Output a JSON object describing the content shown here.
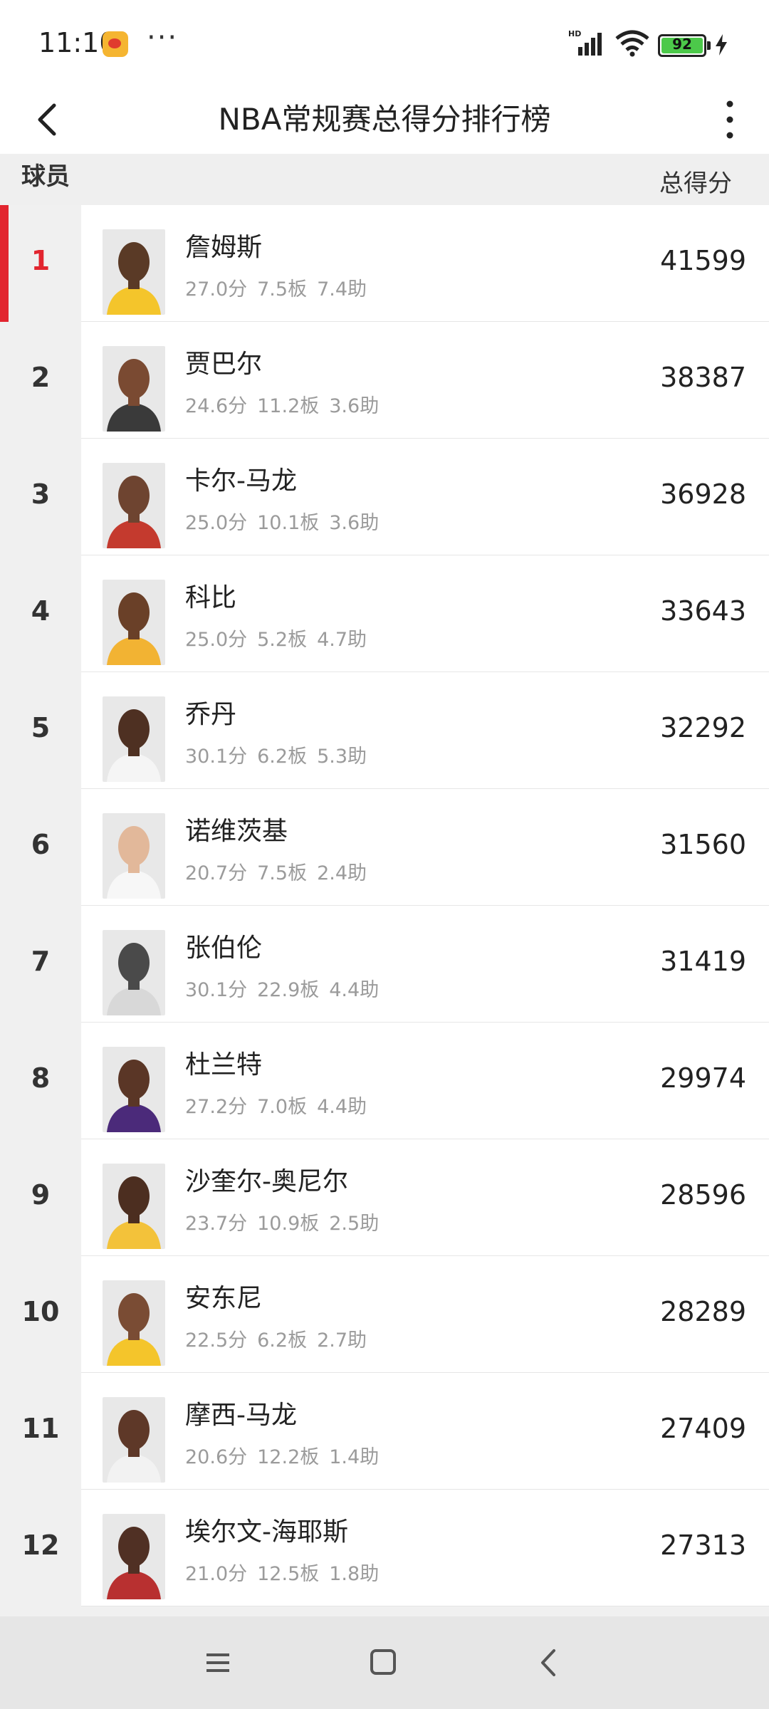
{
  "status_bar": {
    "time": "11:10",
    "more": "···",
    "battery_level": "92",
    "icons": [
      "weibo-icon",
      "signal-icon",
      "wifi-icon",
      "battery-icon",
      "charging-icon"
    ]
  },
  "header": {
    "title": "NBA常规赛总得分排行榜",
    "back_icon": "chevron-left-icon",
    "menu_icon": "more-vertical-icon"
  },
  "columns": {
    "player": "球员",
    "points": "总得分"
  },
  "rows": [
    {
      "rank": "1",
      "name": "詹姆斯",
      "pts": "27.0分",
      "reb": "7.5板",
      "ast": "7.4助",
      "total": "41599",
      "jersey": "#f4c52b",
      "skin": "#5a3a26"
    },
    {
      "rank": "2",
      "name": "贾巴尔",
      "pts": "24.6分",
      "reb": "11.2板",
      "ast": "3.6助",
      "total": "38387",
      "jersey": "#3a3a3a",
      "skin": "#7a4a32"
    },
    {
      "rank": "3",
      "name": "卡尔-马龙",
      "pts": "25.0分",
      "reb": "10.1板",
      "ast": "3.6助",
      "total": "36928",
      "jersey": "#c43a2e",
      "skin": "#6e4430"
    },
    {
      "rank": "4",
      "name": "科比",
      "pts": "25.0分",
      "reb": "5.2板",
      "ast": "4.7助",
      "total": "33643",
      "jersey": "#f2b333",
      "skin": "#6a4028"
    },
    {
      "rank": "5",
      "name": "乔丹",
      "pts": "30.1分",
      "reb": "6.2板",
      "ast": "5.3助",
      "total": "32292",
      "jersey": "#f5f5f5",
      "skin": "#4e3022"
    },
    {
      "rank": "6",
      "name": "诺维茨基",
      "pts": "20.7分",
      "reb": "7.5板",
      "ast": "2.4助",
      "total": "31560",
      "jersey": "#f7f7f7",
      "skin": "#e2b89a"
    },
    {
      "rank": "7",
      "name": "张伯伦",
      "pts": "30.1分",
      "reb": "22.9板",
      "ast": "4.4助",
      "total": "31419",
      "jersey": "#d8d8d8",
      "skin": "#4a4a4a"
    },
    {
      "rank": "8",
      "name": "杜兰特",
      "pts": "27.2分",
      "reb": "7.0板",
      "ast": "4.4助",
      "total": "29974",
      "jersey": "#4b2a7a",
      "skin": "#5a3626"
    },
    {
      "rank": "9",
      "name": "沙奎尔-奥尼尔",
      "pts": "23.7分",
      "reb": "10.9板",
      "ast": "2.5助",
      "total": "28596",
      "jersey": "#f3c23a",
      "skin": "#4c2e20"
    },
    {
      "rank": "10",
      "name": "安东尼",
      "pts": "22.5分",
      "reb": "6.2板",
      "ast": "2.7助",
      "total": "28289",
      "jersey": "#f4c52b",
      "skin": "#7a4c34"
    },
    {
      "rank": "11",
      "name": "摩西-马龙",
      "pts": "20.6分",
      "reb": "12.2板",
      "ast": "1.4助",
      "total": "27409",
      "jersey": "#f2f2f2",
      "skin": "#5e3828"
    },
    {
      "rank": "12",
      "name": "埃尔文-海耶斯",
      "pts": "21.0分",
      "reb": "12.5板",
      "ast": "1.8助",
      "total": "27313",
      "jersey": "#b83030",
      "skin": "#503024"
    }
  ],
  "bottom_nav": {
    "icons": [
      "menu-icon",
      "home-square-icon",
      "back-triangle-icon"
    ]
  },
  "colors": {
    "accent": "#e2252f",
    "background": "#f0f0f0",
    "stats_text": "#9b9b9b"
  }
}
